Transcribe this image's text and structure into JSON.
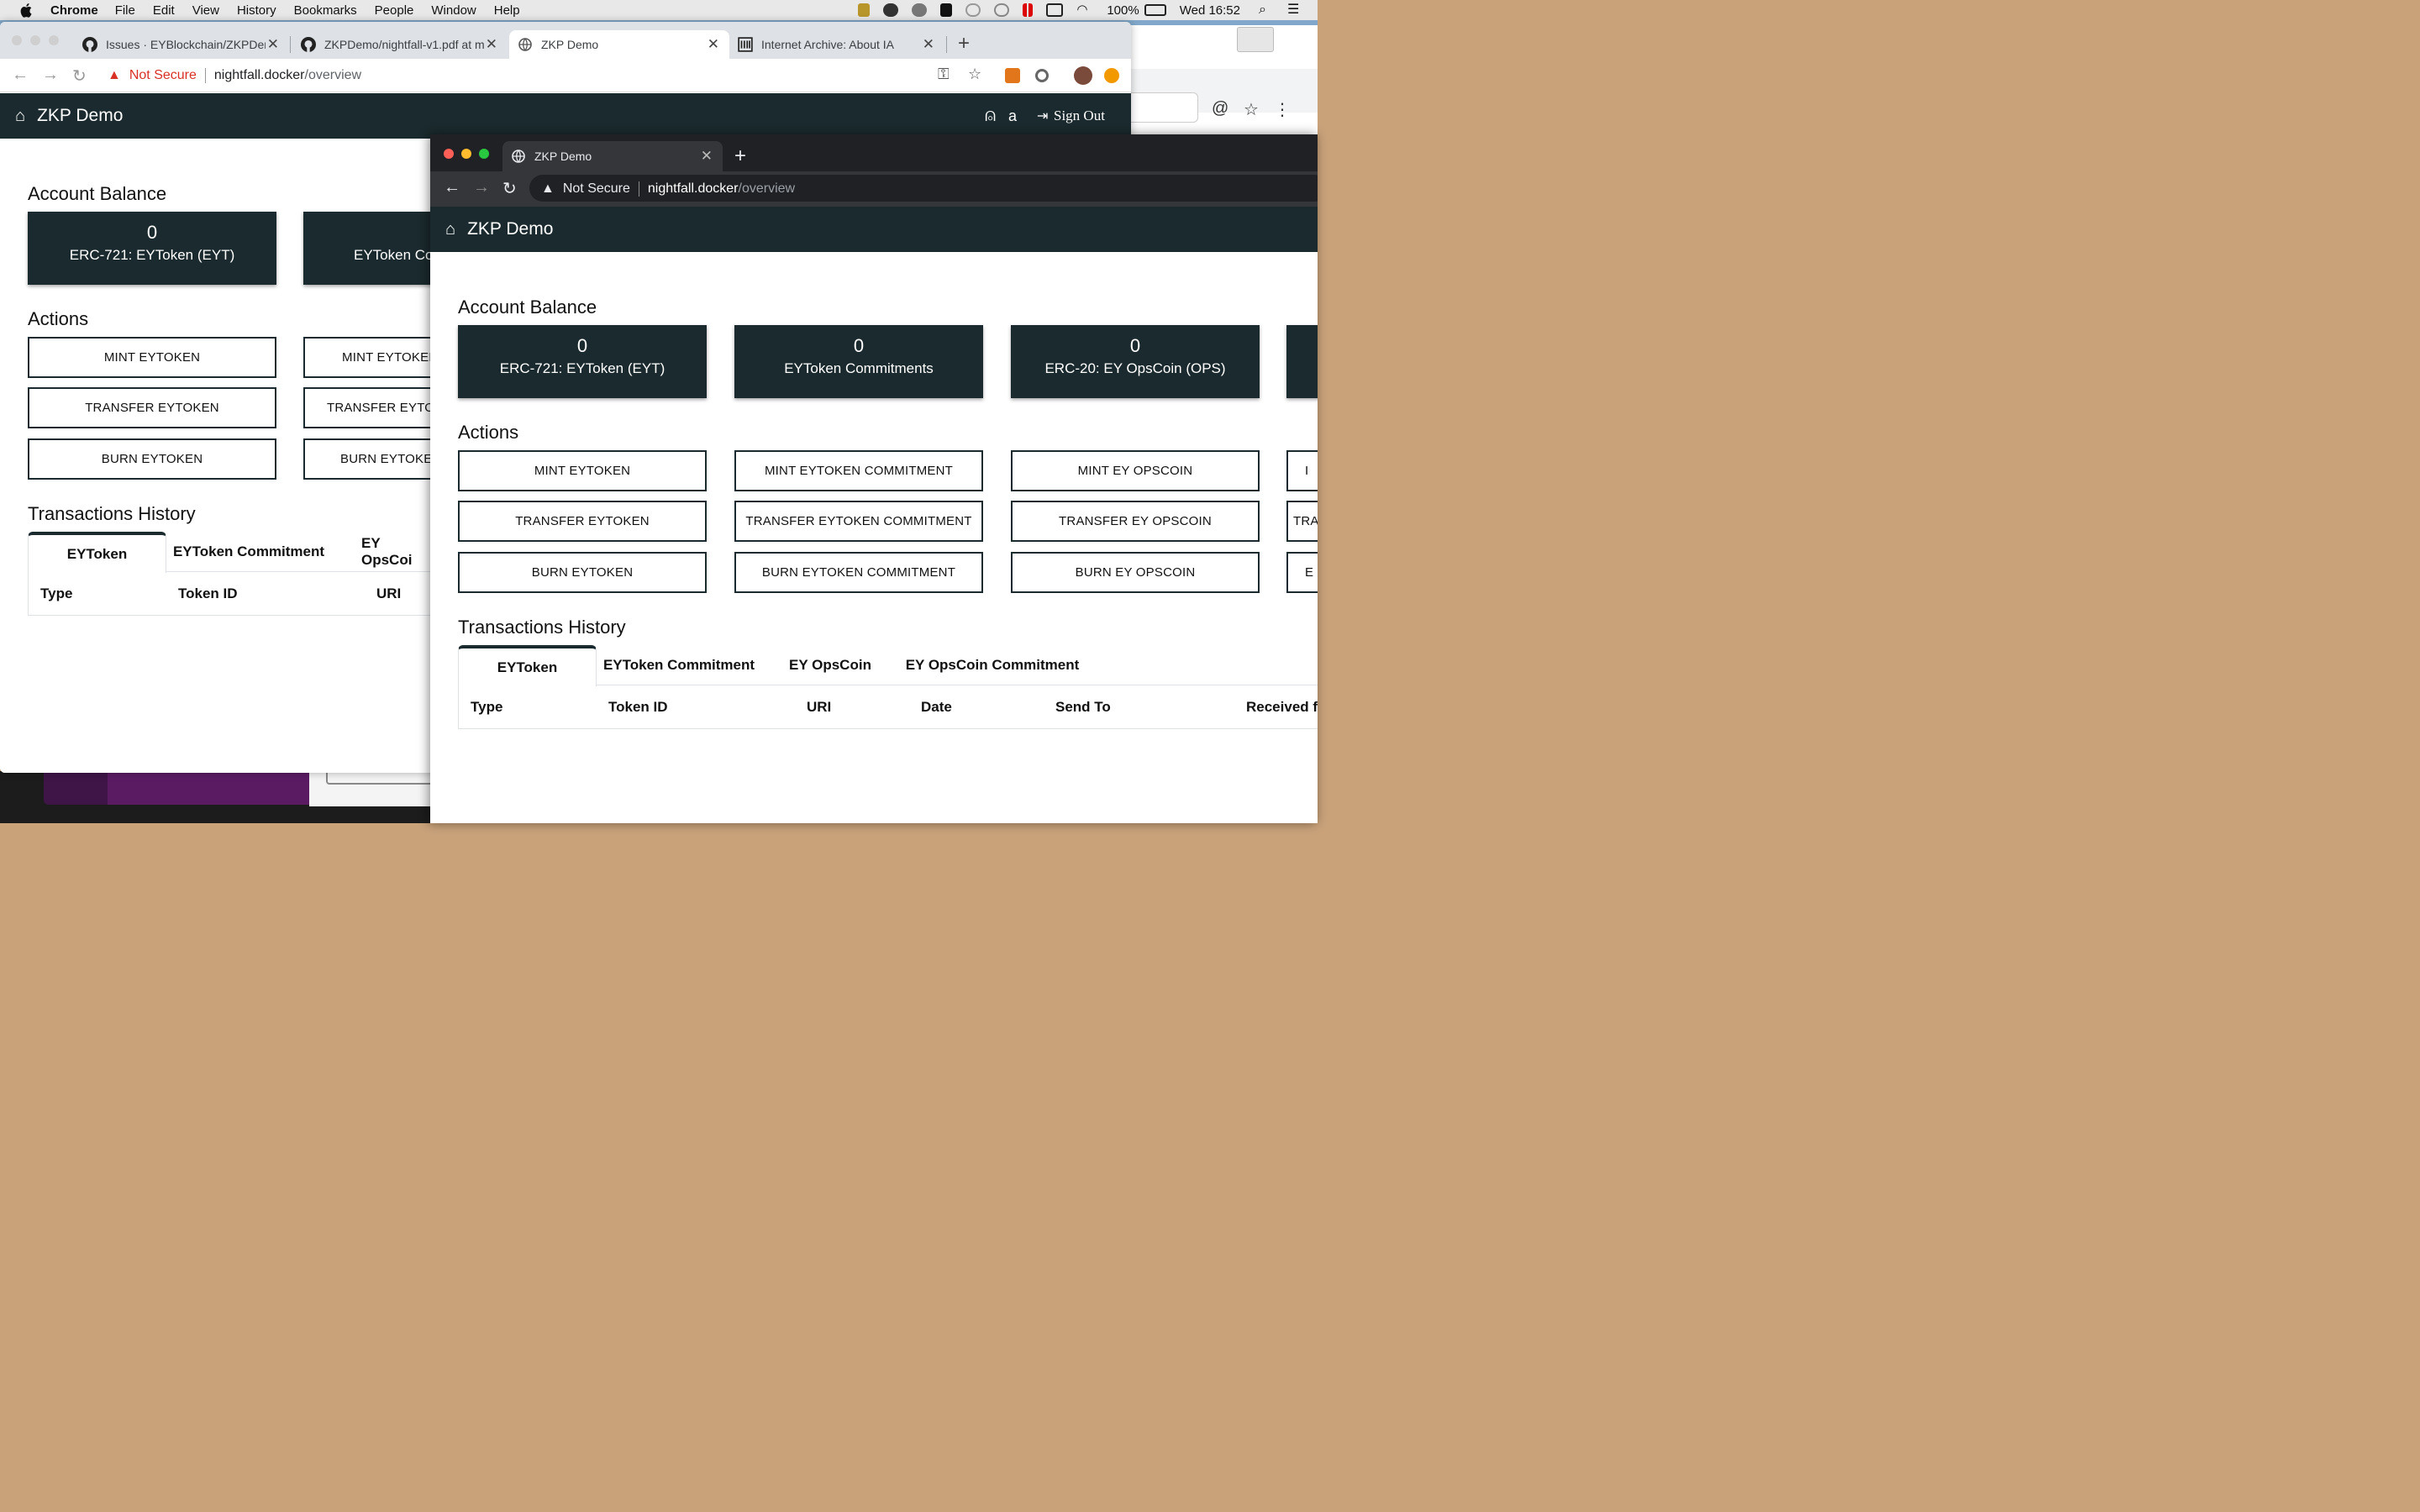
{
  "menubar": {
    "app": "Chrome",
    "items": [
      "File",
      "Edit",
      "View",
      "History",
      "Bookmarks",
      "People",
      "Window",
      "Help"
    ],
    "battery": "100%",
    "clock": "Wed 16:52"
  },
  "back_window": {
    "tabs": [
      {
        "title": "Issues · EYBlockchain/ZKPDem",
        "icon": "github-icon"
      },
      {
        "title": "ZKPDemo/nightfall-v1.pdf at m",
        "icon": "github-icon"
      },
      {
        "title": "ZKP Demo",
        "icon": "globe-icon"
      },
      {
        "title": "Internet Archive: About IA",
        "icon": "archive-icon"
      }
    ],
    "address": {
      "security": "Not Secure",
      "host": "nightfall.docker",
      "path": "/overview"
    },
    "navbar": {
      "brand": "ZKP Demo",
      "user": "a",
      "signout": "Sign Out"
    },
    "account_balance_title": "Account Balance",
    "cards": [
      {
        "value": "0",
        "label": "ERC-721: EYToken (EYT)"
      },
      {
        "value": "0",
        "label": "EYToken Co"
      }
    ],
    "actions_title": "Actions",
    "actions": [
      [
        "MINT EYTOKEN",
        "MINT EYTOKEN"
      ],
      [
        "TRANSFER EYTOKEN",
        "TRANSFER EYTOKI"
      ],
      [
        "BURN EYTOKEN",
        "BURN EYTOKEN"
      ]
    ],
    "history_title": "Transactions History",
    "history_tabs": [
      "EYToken",
      "EYToken Commitment",
      "EY OpsCoi"
    ],
    "columns": [
      "Type",
      "Token ID",
      "URI"
    ]
  },
  "front_window": {
    "tab": {
      "title": "ZKP Demo"
    },
    "address": {
      "security": "Not Secure",
      "host": "nightfall.docker",
      "path": "/overview"
    },
    "navbar": {
      "brand": "ZKP Demo"
    },
    "account_balance_title": "Account Balance",
    "cards": [
      {
        "value": "0",
        "label": "ERC-721: EYToken (EYT)"
      },
      {
        "value": "0",
        "label": "EYToken Commitments"
      },
      {
        "value": "0",
        "label": "ERC-20: EY OpsCoin (OPS)"
      }
    ],
    "actions_title": "Actions",
    "actions": [
      [
        "MINT EYTOKEN",
        "MINT EYTOKEN COMMITMENT",
        "MINT EY OPSCOIN",
        "I"
      ],
      [
        "TRANSFER EYTOKEN",
        "TRANSFER EYTOKEN COMMITMENT",
        "TRANSFER EY OPSCOIN",
        "TRA"
      ],
      [
        "BURN EYTOKEN",
        "BURN EYTOKEN COMMITMENT",
        "BURN EY OPSCOIN",
        "E"
      ]
    ],
    "history_title": "Transactions History",
    "history_tabs": [
      "EYToken",
      "EYToken Commitment",
      "EY OpsCoin",
      "EY OpsCoin Commitment"
    ],
    "columns": [
      "Type",
      "Token ID",
      "URI",
      "Date",
      "Send To",
      "Received fr"
    ]
  },
  "colors": {
    "navbar": "#1b2a2e",
    "not_secure": "#d93025",
    "chrome_dark": "#202124"
  }
}
